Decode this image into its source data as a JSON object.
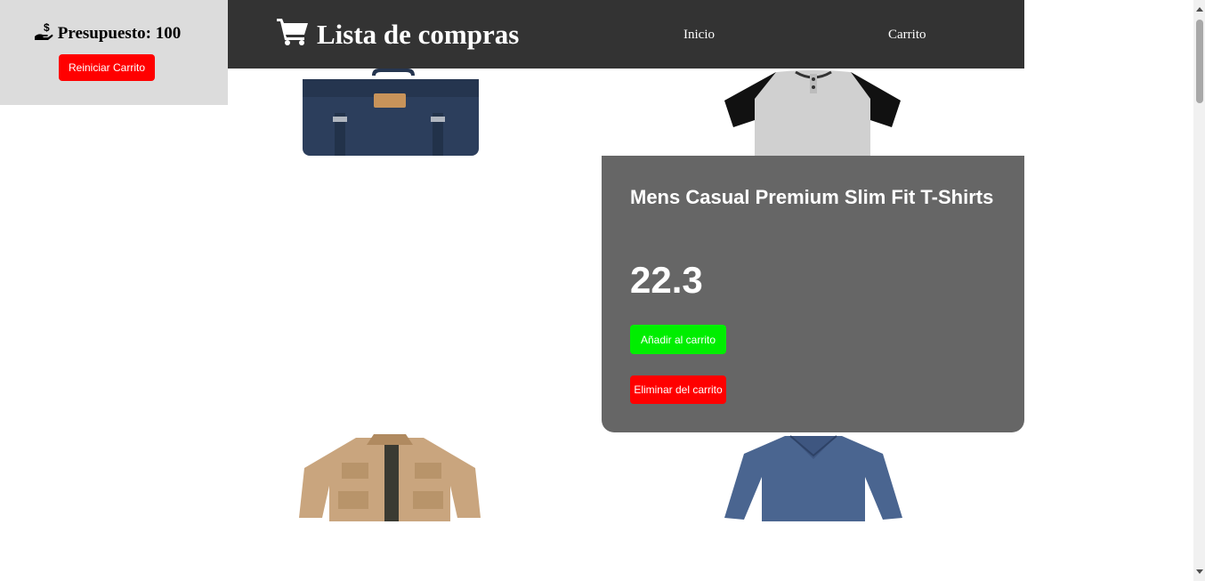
{
  "budget": {
    "icon": "hand-money-icon",
    "label": "Presupuesto: 100",
    "reset_label": "Reiniciar Carrito"
  },
  "header": {
    "icon": "shopping-cart-icon",
    "title": "Lista de compras",
    "nav": [
      "Inicio",
      "Carrito"
    ]
  },
  "products": [
    {
      "image": "navy-backpack"
    },
    {
      "image": "raglan-tshirt"
    },
    {
      "image": "khaki-jacket"
    },
    {
      "image": "blue-longsleeve-shirt"
    }
  ],
  "detail": {
    "title": "Mens Casual Premium Slim Fit T-Shirts",
    "price": "22.3",
    "add_label": "Añadir al carrito",
    "remove_label": "Eliminar del carrito"
  },
  "colors": {
    "header_bg": "#333333",
    "panel_bg": "#dcdcdc",
    "card_bg": "#666666",
    "add_green": "#00ee00",
    "danger_red": "#ff0000"
  }
}
